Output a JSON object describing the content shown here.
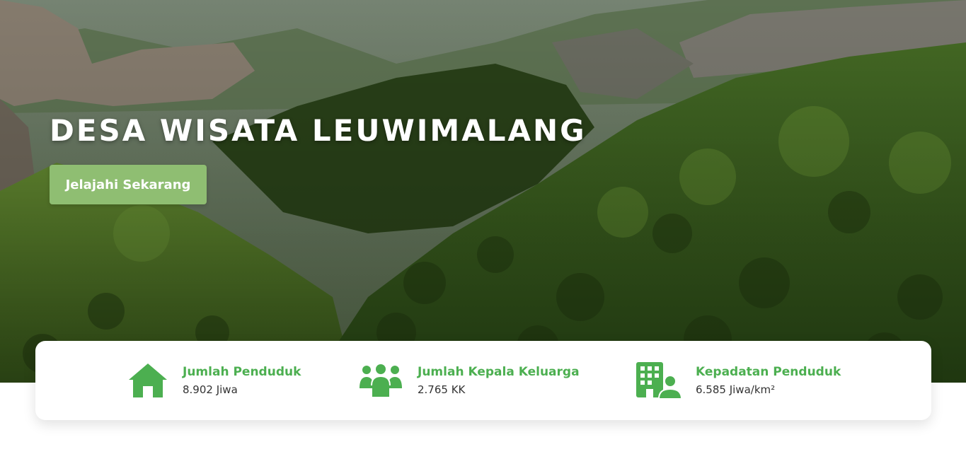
{
  "hero": {
    "title": "DESA WISATA LEUWIMALANG",
    "cta_label": "Jelajahi Sekarang",
    "background": "mountain-valley-photo"
  },
  "stats": [
    {
      "icon": "house-icon",
      "label": "Jumlah Penduduk",
      "value": "8.902 Jiwa"
    },
    {
      "icon": "people-group-icon",
      "label": "Jumlah Kepala Keluarga",
      "value": "2.765 KK"
    },
    {
      "icon": "building-person-icon",
      "label": "Kepadatan Penduduk",
      "value": "6.585 Jiwa/km²"
    }
  ],
  "colors": {
    "accent_green": "#4caf50",
    "button_green": "#8fbe72",
    "card_bg": "#ffffff"
  }
}
